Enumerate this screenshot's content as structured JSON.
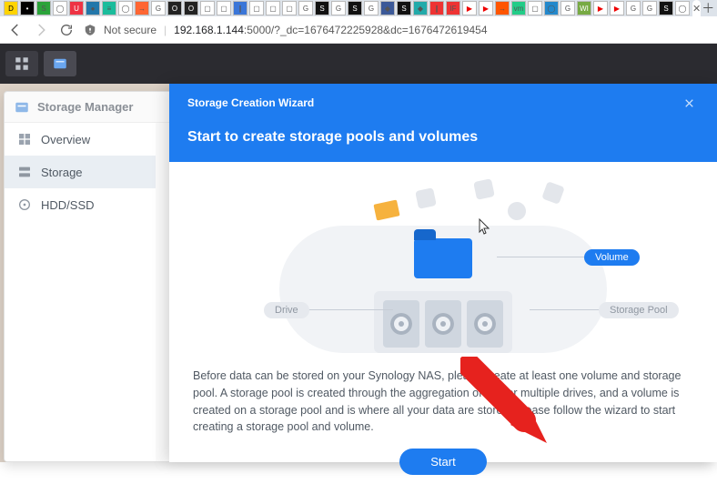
{
  "browser": {
    "security_label": "Not secure",
    "url_host": "192.168.1.144",
    "url_rest": ":5000/?_dc=1676472225928&dc=1676472619454"
  },
  "storage_manager": {
    "title": "Storage Manager",
    "nav": {
      "overview": "Overview",
      "storage": "Storage",
      "hdd_ssd": "HDD/SSD"
    }
  },
  "wizard": {
    "title": "Storage Creation Wizard",
    "subtitle": "Start to create storage pools and volumes",
    "labels": {
      "volume": "Volume",
      "drive": "Drive",
      "storage_pool": "Storage Pool"
    },
    "body_text": "Before data can be stored on your Synology NAS, please create at least one volume and storage pool. A storage pool is created through the aggregation of one or multiple drives, and a volume is created on a storage pool and is where all your data are stored. Please follow the wizard to start creating a storage pool and volume.",
    "start_button": "Start"
  }
}
